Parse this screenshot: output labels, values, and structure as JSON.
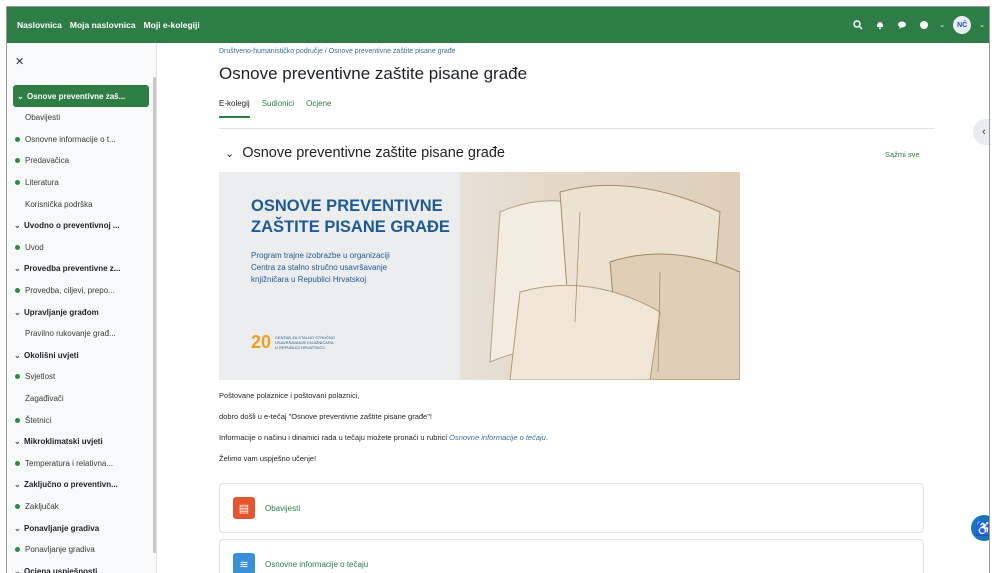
{
  "topbar": {
    "nav": [
      "Naslovnica",
      "Moja naslovnica",
      "Moji e-kolegiji"
    ],
    "avatar": "NČ"
  },
  "sidebar": {
    "items": [
      {
        "label": "Osnove preventivne zaš...",
        "kind": "section",
        "active": true
      },
      {
        "label": "Obavijesti",
        "kind": "plain"
      },
      {
        "label": "Osnovne informacije o t...",
        "kind": "dot"
      },
      {
        "label": "Predavačica",
        "kind": "dot"
      },
      {
        "label": "Literatura",
        "kind": "dot"
      },
      {
        "label": "Korisnička podrška",
        "kind": "plain"
      },
      {
        "label": "Uvodno o preventivnoj ...",
        "kind": "section"
      },
      {
        "label": "Uvod",
        "kind": "dot"
      },
      {
        "label": "Provedba preventivne z...",
        "kind": "section"
      },
      {
        "label": "Provedba, ciljevi, prepo...",
        "kind": "dot"
      },
      {
        "label": "Upravljanje građom",
        "kind": "section"
      },
      {
        "label": "Pravilno rukovanje građ...",
        "kind": "plain"
      },
      {
        "label": "Okolišni uvjeti",
        "kind": "section"
      },
      {
        "label": "Svjetlost",
        "kind": "dot"
      },
      {
        "label": "Zagađivači",
        "kind": "plain"
      },
      {
        "label": "Štetnici",
        "kind": "dot"
      },
      {
        "label": "Mikroklimatski uvjeti",
        "kind": "section"
      },
      {
        "label": "Temperatura i relativna...",
        "kind": "dot"
      },
      {
        "label": "Zaključno o preventivn...",
        "kind": "section"
      },
      {
        "label": "Zaključak",
        "kind": "dot"
      },
      {
        "label": "Ponavljanje gradiva",
        "kind": "section"
      },
      {
        "label": "Ponavljanje gradiva",
        "kind": "dot"
      },
      {
        "label": "Ocjena uspješnosti",
        "kind": "section"
      }
    ]
  },
  "main": {
    "breadcrumb": "Društveno-humanističko područje / Osnove preventivne zaštite pisane građe",
    "title": "Osnove preventivne zaštite pisane građe",
    "tabs": [
      "E-kolegij",
      "Sudionici",
      "Ocjene"
    ],
    "section_title": "Osnove preventivne zaštite pisane građe",
    "collapse_all": "Sažmi sve",
    "banner": {
      "heading_line1": "OSNOVE PREVENTIVNE",
      "heading_line2": "ZAŠTITE PISANE GRAĐE",
      "sub_line1": "Program trajne izobrazbe u organizaciji",
      "sub_line2": "Centra za stalno stručno usavršavanje",
      "sub_line3": "knjižničara u Republici Hrvatskoj",
      "logo_number": "20",
      "logo_text_line1": "CENTAR ZA STALNO STRUČNO",
      "logo_text_line2": "USAVRŠAVANJE KNJIŽNIČARA",
      "logo_text_line3": "U REPUBLICI HRVATSKOJ"
    },
    "paragraphs": {
      "p1": "Poštovane polaznice i poštovani polaznici,",
      "p2": "dobro došli u e-tečaj \"Osnove preventivne zaštite pisane građe\"!",
      "p3_text": "Informacije o načinu i dinamici rada u tečaju možete pronaći u rubrici ",
      "p3_link": "Osnovne informacije o tečaju",
      "p3_end": ".",
      "p4": "Želimo vam uspješno učenje!"
    },
    "cards": [
      {
        "label": "Obavijesti",
        "color": "#e4572e"
      },
      {
        "label": "Osnovne informacije o tečaju",
        "color": "#3a8fd6"
      }
    ]
  },
  "colors": {
    "brand": "#2e7d46",
    "link": "#3a6e9c",
    "banner_text": "#1f5b93"
  }
}
